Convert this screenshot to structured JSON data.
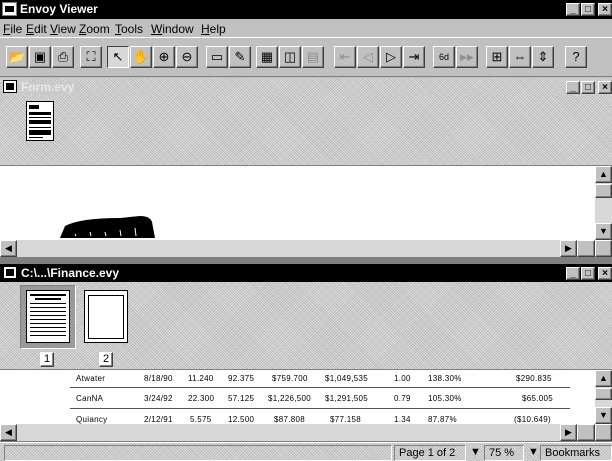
{
  "app": {
    "title": "Envoy Viewer"
  },
  "menu": [
    "File",
    "Edit",
    "View",
    "Zoom",
    "Tools",
    "Window",
    "Help"
  ],
  "toolbar": {
    "icons": [
      "open-icon",
      "save-icon",
      "print-icon",
      "find-icon",
      "select-arrow-icon",
      "hand-icon",
      "zoom-in-icon",
      "zoom-out-icon",
      "note-icon",
      "highlight-icon",
      "thumbnails-icon",
      "bookmarks-icon",
      "thumbnail-wide-icon",
      "first-page-icon",
      "prev-page-icon",
      "next-page-icon",
      "last-page-icon",
      "back-icon",
      "forward-icon",
      "fit-page-icon",
      "fit-width-icon",
      "fit-height-icon",
      "help-icon"
    ],
    "glyphs": {
      "open": "📂",
      "save": "▣",
      "print": "⎙",
      "find": "⛶",
      "select": "↖",
      "hand": "✋",
      "zoom_in": "⊕",
      "zoom_out": "⊖",
      "note": "▭",
      "highlight": "✎",
      "thumbnails": "▦",
      "bookmarks": "◫",
      "thumb_wide": "▤",
      "first": "⇤",
      "prev": "◁",
      "next": "▷",
      "last": "⇥",
      "back": "◀◀",
      "forward": "▶▶",
      "fit_page": "⊞",
      "fit_width": "⇔",
      "fit_height": "⇕",
      "help": "?"
    },
    "back_label": "6d",
    "forward_label": "▷"
  },
  "window_controls": {
    "minimize": "_",
    "maximize": "□",
    "close": "×"
  },
  "doc1": {
    "title": "Form.evy"
  },
  "doc2": {
    "title": "C:\\...\\Finance.evy",
    "pages": [
      "1",
      "2"
    ],
    "rows": [
      [
        "Atwater",
        "8/18/90",
        "11.240",
        "92.375",
        "$759.700",
        "$1,049,535",
        "1.00",
        "138.30%",
        "$290.835"
      ],
      [
        "CanNA",
        "3/24/92",
        "22.300",
        "57.125",
        "$1,226,500",
        "$1,291,505",
        "0.79",
        "105.30%",
        "$65.005"
      ],
      [
        "Quiancy",
        "2/12/91",
        "5.575",
        "12.500",
        "$87.808",
        "$77.158",
        "1.34",
        "87.87%",
        "($10.649)"
      ]
    ]
  },
  "status": {
    "page": "Page 1 of 2",
    "zoom": "75 %",
    "bookmarks": "Bookmarks"
  },
  "colors": {
    "titlebar": "#000000",
    "background": "#c0c0c0",
    "doc_titlebar_active": "#c8c8c8"
  }
}
